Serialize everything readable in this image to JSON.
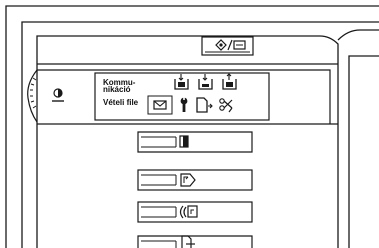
{
  "panel": {
    "comm_label_line1": "Kommu-",
    "comm_label_line2": "nikáció",
    "received_file_label": "Vételi file"
  },
  "icons": {
    "top_key": "mode-switch-key-icon",
    "contrast": "contrast-dial-icon",
    "tray_row": [
      "tray-receive-icon",
      "tray-print-icon",
      "tray-send-icon"
    ],
    "file_row": [
      "received-file-envelope-icon",
      "wrench-icon",
      "document-send-icon",
      "scissors-tool-icon"
    ],
    "side_buttons": [
      "original-document-icon",
      "refresh-document-icon",
      "copy-document-icon",
      "print-document-icon"
    ]
  },
  "colors": {
    "line": "#1a1a1a",
    "bg": "#ffffff",
    "highlight": "#ffffff"
  }
}
